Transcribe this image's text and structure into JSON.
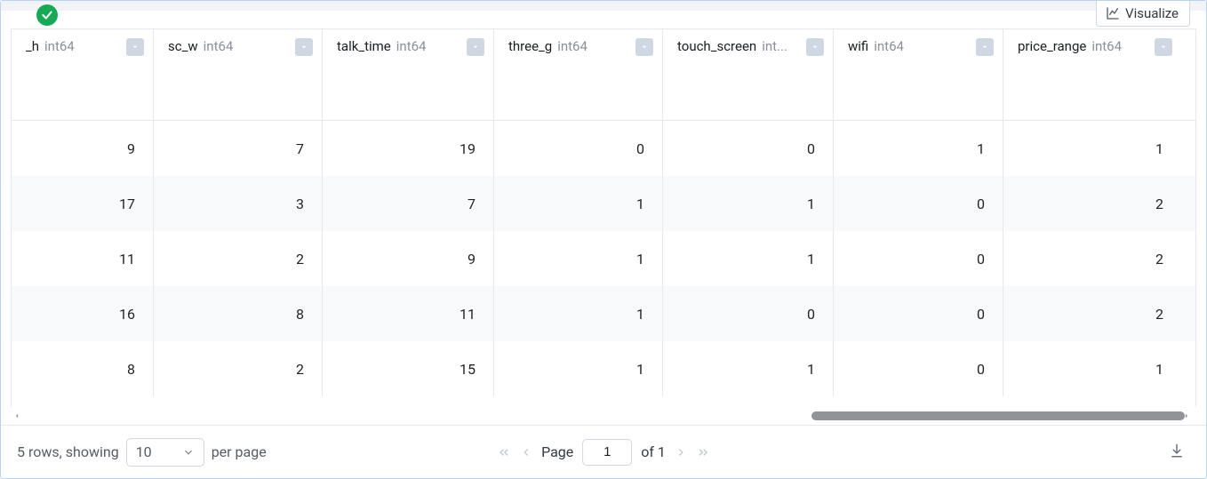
{
  "visualize_label": "Visualize",
  "columns": [
    {
      "name": "_h",
      "type": "int64"
    },
    {
      "name": "sc_w",
      "type": "int64"
    },
    {
      "name": "talk_time",
      "type": "int64"
    },
    {
      "name": "three_g",
      "type": "int64"
    },
    {
      "name": "touch_screen",
      "type": "int..."
    },
    {
      "name": "wifi",
      "type": "int64"
    },
    {
      "name": "price_range",
      "type": "int64"
    }
  ],
  "rows": [
    {
      "_h": "9",
      "sc_w": "7",
      "talk_time": "19",
      "three_g": "0",
      "touch_screen": "0",
      "wifi": "1",
      "price_range": "1"
    },
    {
      "_h": "17",
      "sc_w": "3",
      "talk_time": "7",
      "three_g": "1",
      "touch_screen": "1",
      "wifi": "0",
      "price_range": "2"
    },
    {
      "_h": "11",
      "sc_w": "2",
      "talk_time": "9",
      "three_g": "1",
      "touch_screen": "1",
      "wifi": "0",
      "price_range": "2"
    },
    {
      "_h": "16",
      "sc_w": "8",
      "talk_time": "11",
      "three_g": "1",
      "touch_screen": "0",
      "wifi": "0",
      "price_range": "2"
    },
    {
      "_h": "8",
      "sc_w": "2",
      "talk_time": "15",
      "three_g": "1",
      "touch_screen": "1",
      "wifi": "0",
      "price_range": "1"
    }
  ],
  "footer": {
    "rows_showing_prefix": "5 rows, showing",
    "per_page_value": "10",
    "per_page_suffix": "per page",
    "page_label": "Page",
    "page_value": "1",
    "of_label": "of 1"
  }
}
